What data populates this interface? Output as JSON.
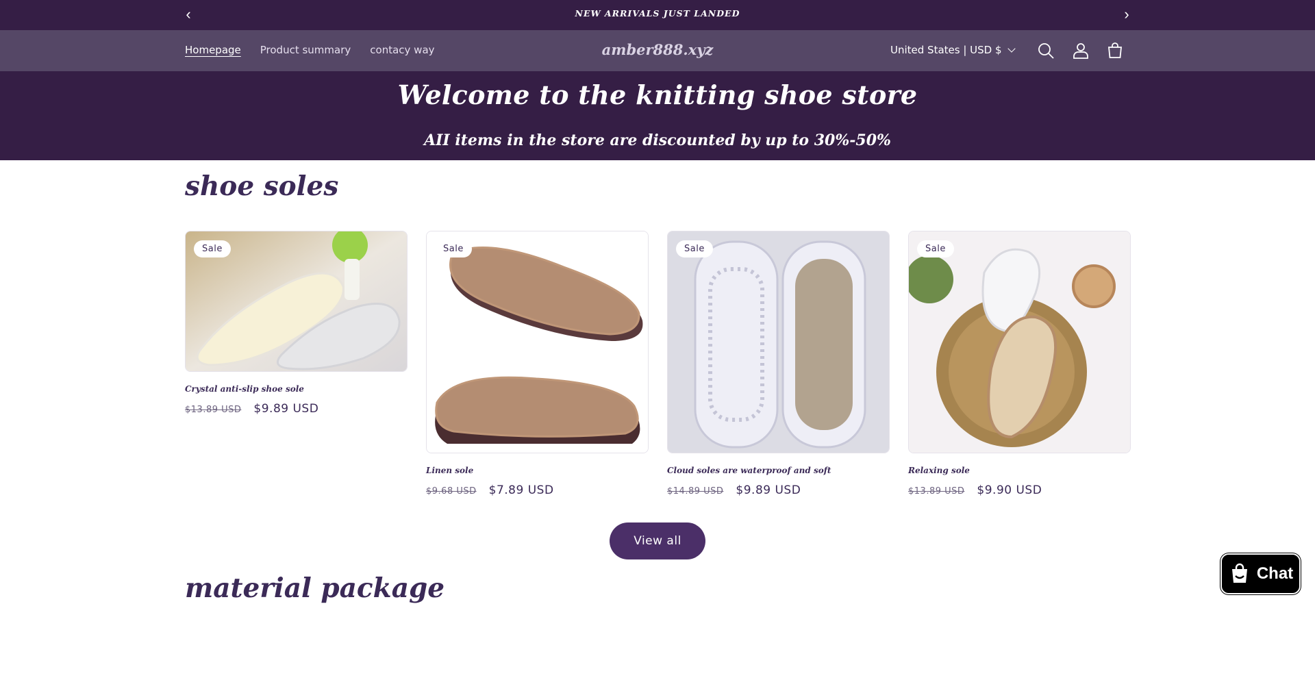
{
  "announcement": {
    "message": "NEW ARRIVALS JUST LANDED",
    "prev_icon": "chevron-left-icon",
    "next_icon": "chevron-right-icon"
  },
  "header": {
    "nav": [
      {
        "label": "Homepage"
      },
      {
        "label": "Product summary"
      },
      {
        "label": "contacy way"
      }
    ],
    "logo": "amber888.xyz",
    "country": "United States | USD $",
    "icons": [
      "search-icon",
      "account-icon",
      "cart-icon"
    ]
  },
  "hero": {
    "title": "Welcome to the knitting shoe store",
    "subtitle": "AII items in the store are discounted by up to 30%-50%"
  },
  "sections": [
    {
      "title": "shoe soles"
    },
    {
      "title": "material package"
    }
  ],
  "products": [
    {
      "badge": "Sale",
      "title": "Crystal anti-slip shoe sole",
      "old_price": "$13.89 USD",
      "new_price": "$9.89 USD"
    },
    {
      "badge": "Sale",
      "title": "Linen sole",
      "old_price": "$9.68 USD",
      "new_price": "$7.89 USD"
    },
    {
      "badge": "Sale",
      "title": "Cloud soles are waterproof and soft",
      "old_price": "$14.89 USD",
      "new_price": "$9.89 USD"
    },
    {
      "badge": "Sale",
      "title": "Relaxing sole",
      "old_price": "$13.89 USD",
      "new_price": "$9.90 USD"
    }
  ],
  "view_all_label": "View all",
  "chat": {
    "label": "Chat",
    "icon": "shopping-bag-icon"
  },
  "colors": {
    "accent": "#351e45",
    "header": "#554766",
    "button": "#4b2f68"
  }
}
